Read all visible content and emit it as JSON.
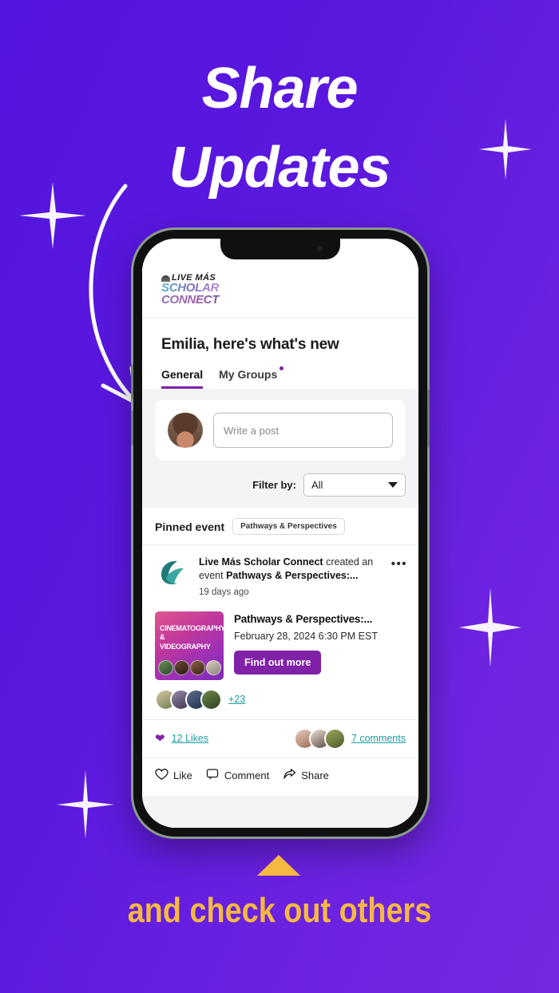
{
  "poster": {
    "headline_line1": "Share",
    "headline_line2": "Updates",
    "caption": "and check out others",
    "headline_color": "#FFFFFF",
    "caption_color": "#F5B942",
    "background_color": "#5A18DE",
    "accent_purple": "#8021A8",
    "link_teal": "#1F9E9E"
  },
  "app": {
    "logo": {
      "line1": "LIVE MÁS",
      "line2": "SCHOLAR",
      "line3": "CONNECT"
    },
    "greeting": "Emilia, here's what's new",
    "tabs": [
      {
        "label": "General",
        "active": true,
        "has_dot": false
      },
      {
        "label": "My Groups",
        "active": false,
        "has_dot": true
      }
    ],
    "composer": {
      "placeholder": "Write a post"
    },
    "filter": {
      "label": "Filter by:",
      "value": "All"
    },
    "pinned": {
      "label": "Pinned event",
      "chip": "Pathways & Perspectives"
    },
    "post": {
      "author": "Live Más Scholar Connect",
      "action_text": "created an event",
      "event_ref": "Pathways & Perspectives:...",
      "timestamp": "19 days ago",
      "more_menu": "•••"
    },
    "event": {
      "thumb_title_line1": "CINEMATOGRAPHY",
      "thumb_title_line2": "& VIDEOGRAPHY",
      "title": "Pathways & Perspectives:...",
      "date": "February 28, 2024 6:30 PM EST",
      "cta": "Find out more",
      "attendees_more": "+23"
    },
    "social": {
      "likes": "12 Likes",
      "comments": "7 comments"
    },
    "actions": [
      {
        "label": "Like",
        "icon": "heart-icon"
      },
      {
        "label": "Comment",
        "icon": "comment-icon"
      },
      {
        "label": "Share",
        "icon": "share-icon"
      }
    ]
  }
}
